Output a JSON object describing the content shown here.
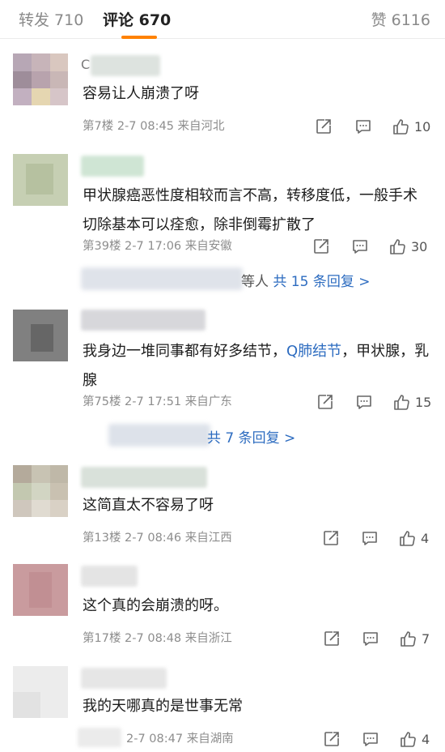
{
  "tabs": {
    "repost": "转发 710",
    "comments": "评论 670",
    "likes": "赞 6116"
  },
  "comments": [
    {
      "name_lead": "C",
      "text": "容易让人崩溃了呀",
      "meta": "第7楼  2-7 08:45  来自河北",
      "likes": "10"
    },
    {
      "text": "甲状腺癌恶性度相较而言不高，转移度低，一般手术切除基本可以痊愈，除非倒霉扩散了",
      "meta": "第39楼  2-7 17:06  来自安徽",
      "likes": "30",
      "replies_prefix": "等人",
      "replies_link": "共 15 条回复 >"
    },
    {
      "text_before": "我身边一堆同事都有好多结节，",
      "topic": "Q肺结节",
      "text_after": "，甲状腺，乳腺",
      "meta": "第75楼  2-7 17:51  来自广东",
      "likes": "15",
      "replies_link": "共 7 条回复 >"
    },
    {
      "text": "这简直太不容易了呀",
      "meta": "第13楼  2-7 08:46  来自江西",
      "likes": "4"
    },
    {
      "text": "这个真的会崩溃的呀。",
      "meta": "第17楼  2-7 08:48  来自浙江",
      "likes": "7"
    },
    {
      "text": "我的天哪真的是世事无常",
      "meta": "2-7 08:47  来自湖南",
      "likes": "4"
    }
  ],
  "colors": {
    "accent": "#ff8200",
    "link": "#2d6cc0",
    "muted": "#8d8d8d"
  },
  "icons": [
    "share-icon",
    "comment-icon",
    "thumbs-up-icon"
  ]
}
